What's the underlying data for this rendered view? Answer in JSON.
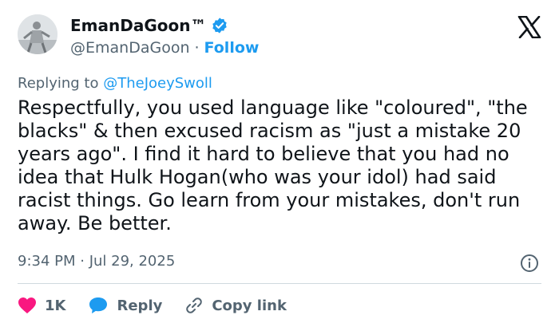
{
  "tweet": {
    "author": {
      "display_name": "EmanDaGoon™",
      "handle": "@EmanDaGoon",
      "separator": "·",
      "follow_label": "Follow",
      "verified": true
    },
    "reply_prefix": "Replying to",
    "reply_handle": "@TheJoeySwoll",
    "text": "Respectfully, you used language like \"coloured\", \"the blacks\" & then excused racism as \"just a mistake 20 years ago\". I find it hard to believe that you had no idea that Hulk Hogan(who was your idol) had said racist things. Go learn from your mistakes, don't run away. Be better.",
    "timestamp": "9:34 PM · Jul 29, 2025",
    "actions": {
      "like_count": "1K",
      "reply_label": "Reply",
      "copy_link_label": "Copy link"
    }
  },
  "colors": {
    "link": "#1d9bf0",
    "secondary_text": "#536471",
    "like": "#f91880",
    "reply": "#1d9bf0",
    "divider": "#cfd9de"
  },
  "icons": [
    "verified-badge-icon",
    "x-logo-icon",
    "info-icon",
    "heart-icon",
    "reply-bubble-icon",
    "link-icon"
  ]
}
